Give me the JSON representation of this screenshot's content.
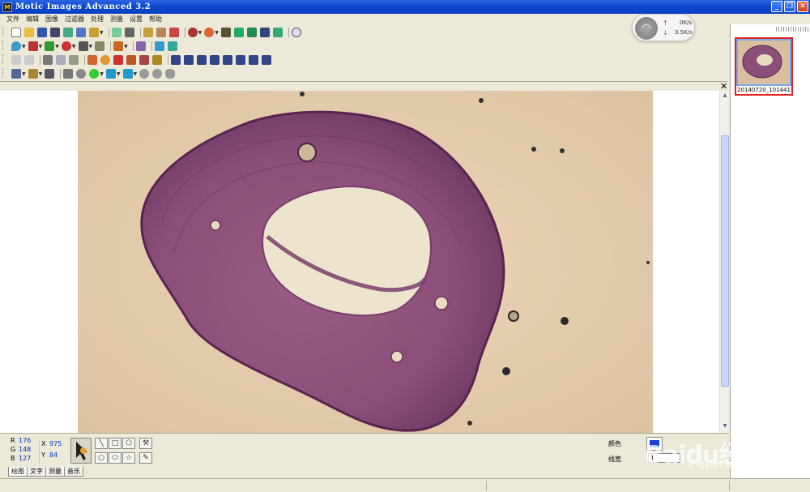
{
  "window": {
    "title": "Motic Images Advanced 3.2"
  },
  "menu": [
    "文件",
    "编辑",
    "图像",
    "过滤器",
    "处理",
    "测量",
    "设置",
    "帮助"
  ],
  "network": {
    "upload": "0K/s",
    "download": "3.5K/s"
  },
  "thumbnail": {
    "label": "20140720_101441"
  },
  "pixel_info": {
    "r": "176",
    "g": "148",
    "b": "127",
    "x": "975",
    "y": "84"
  },
  "bottom_tabs": [
    "绘图",
    "文字",
    "测量",
    "音乐"
  ],
  "props": {
    "color_label": "颜色",
    "width_label": "线宽",
    "line_width": "1"
  },
  "watermark": {
    "brand": "Baidu经验",
    "url": "jingyan.baidu.com"
  },
  "colors": {
    "title_bar": "#0A48D0",
    "stroke_color": "#1a3fd8",
    "thumb_border": "#e02020",
    "tissue": "#8A4E78"
  }
}
